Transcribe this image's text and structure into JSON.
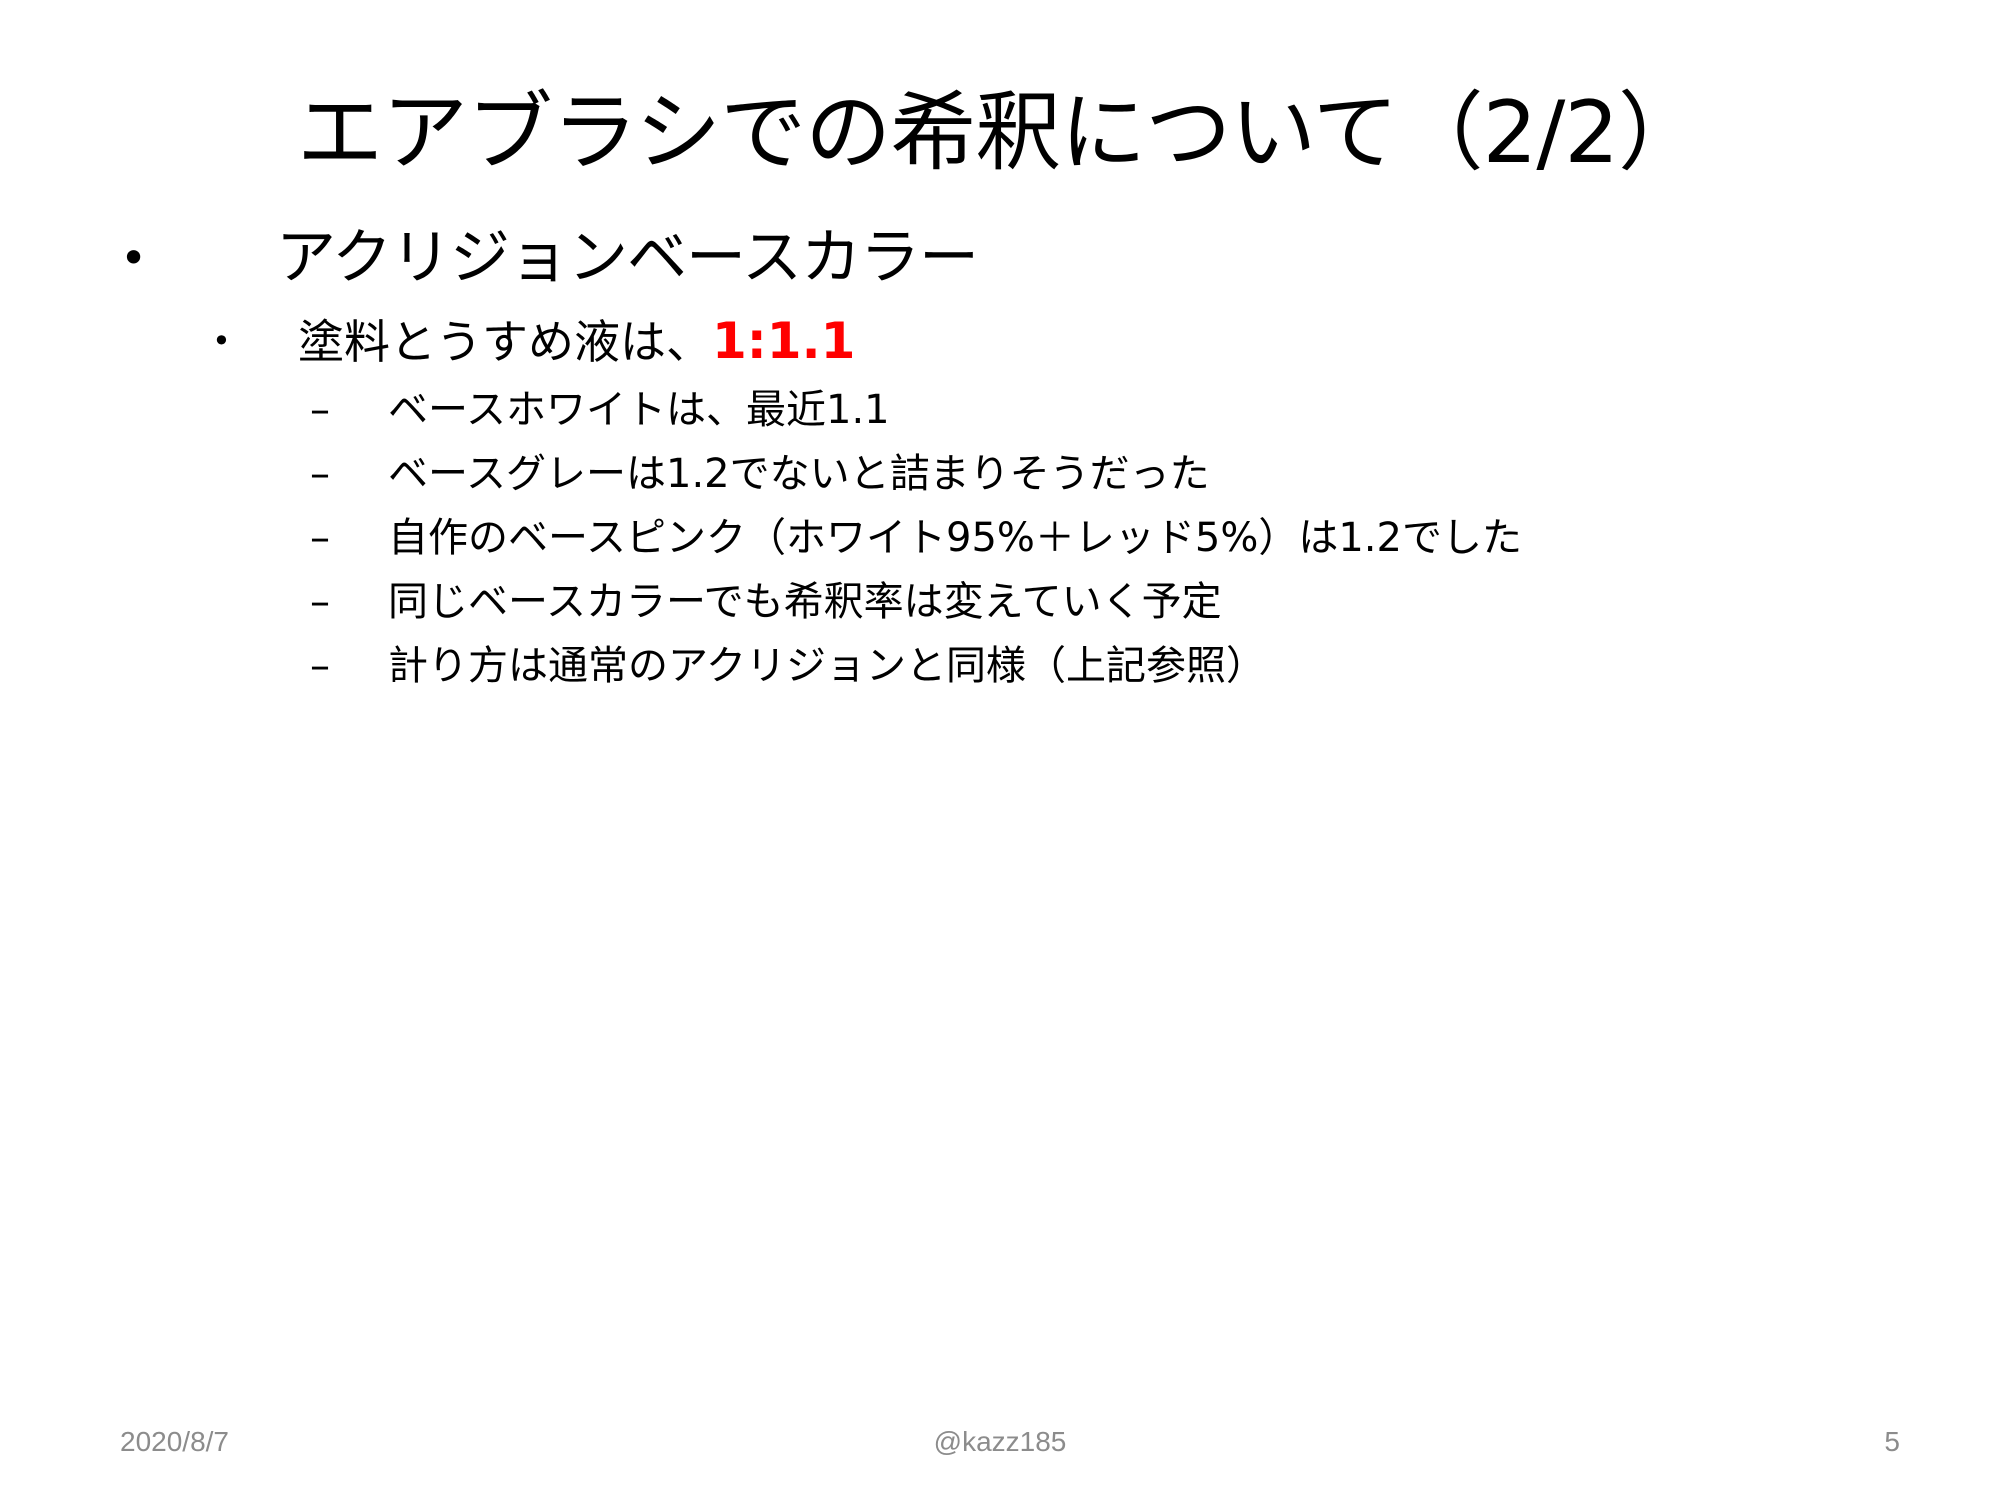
{
  "slide": {
    "title": "エアブラシでの希釈について（2/2）",
    "level1": {
      "bullet": "•",
      "text": "アクリジョンベースカラー"
    },
    "level2": {
      "bullet": "•",
      "text": "塗料とうすめ液は、",
      "highlight": "1:1.1"
    },
    "level3": [
      {
        "dash": "–",
        "text": "ベースホワイトは、最近1.1"
      },
      {
        "dash": "–",
        "text": "ベースグレーは1.2でないと詰まりそうだった"
      },
      {
        "dash": "–",
        "text": "自作のベースピンク（ホワイト95%＋レッド5%）は1.2でした"
      },
      {
        "dash": "–",
        "text": "同じベースカラーでも希釈率は変えていく予定"
      },
      {
        "dash": "–",
        "text": "計り方は通常のアクリジョンと同様（上記参照）"
      }
    ]
  },
  "footer": {
    "date": "2020/8/7",
    "author": "@kazz185",
    "page": "5"
  },
  "colors": {
    "highlight": "#ff0000",
    "footer_text": "#8c8c8c",
    "background": "#ffffff"
  }
}
